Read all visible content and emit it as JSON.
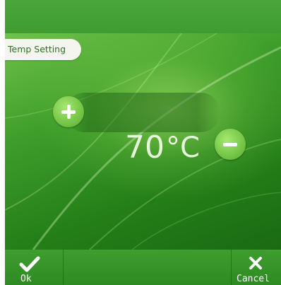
{
  "header": {
    "title": "Temp Setting"
  },
  "temperature": {
    "value": "70",
    "unit": "°C"
  },
  "controls": {
    "increase_icon": "plus-icon",
    "decrease_icon": "minus-icon"
  },
  "footer": {
    "ok_label": "Ok",
    "ok_icon": "check-icon",
    "cancel_label": "Cancel",
    "cancel_icon": "close-icon"
  },
  "colors": {
    "accent": "#3f9c31",
    "button": "#78c84a",
    "text_light": "#e8f6de"
  }
}
